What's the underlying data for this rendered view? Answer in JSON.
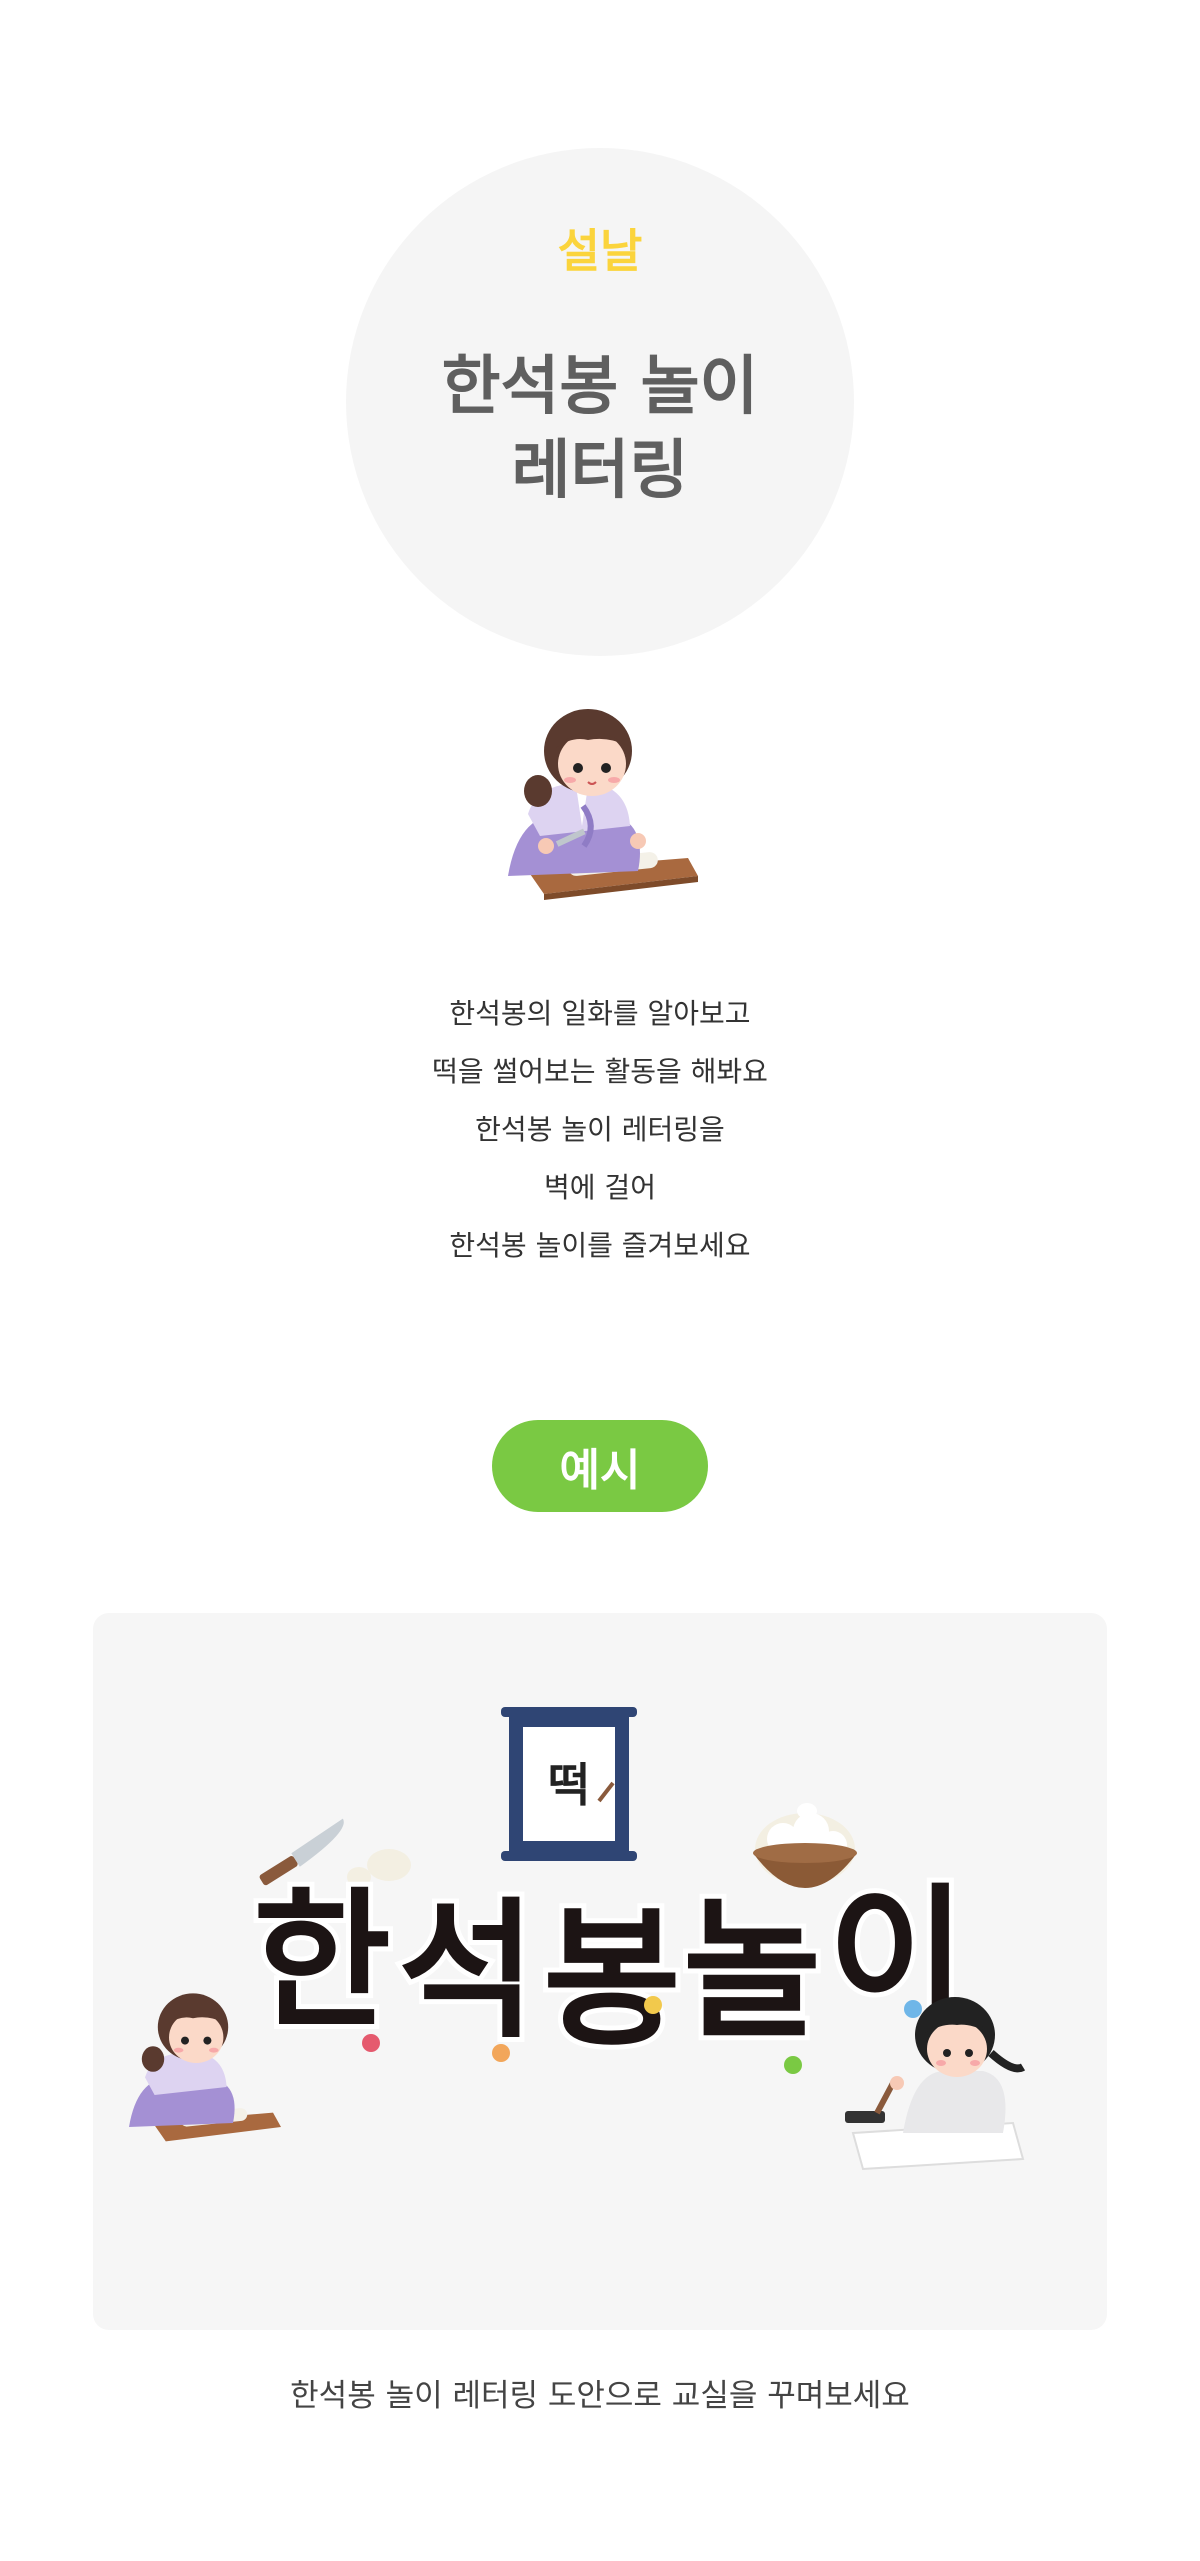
{
  "hero": {
    "category": "설날",
    "title_line1": "한석봉 놀이",
    "title_line2": "레터링"
  },
  "description": [
    "한석봉의 일화를 알아보고",
    "떡을 썰어보는 활동을 해봐요",
    "한석봉 놀이 레터링을",
    "벽에 걸어",
    "한석봉 놀이를 즐겨보세요"
  ],
  "example": {
    "button_label": "예시",
    "scroll_char": "떡",
    "lettering_chars": [
      "한",
      "석",
      "봉",
      "놀",
      "이"
    ]
  },
  "caption": "한석봉 놀이 레터링 도안으로 교실을 꾸며보세요",
  "colors": {
    "accent_yellow": "#fbd43c",
    "accent_green": "#7ac943",
    "title_gray": "#5f5f5f",
    "hanbok_purple": "#b9a6e0"
  }
}
